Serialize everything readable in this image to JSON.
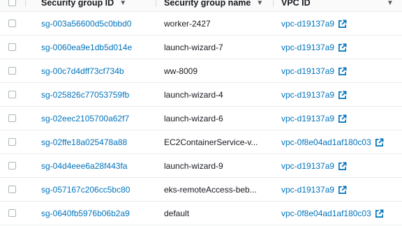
{
  "table": {
    "columns": [
      {
        "label": "Security group ID"
      },
      {
        "label": "Security group name"
      },
      {
        "label": "VPC ID"
      }
    ],
    "sort_icon": "caret-down-icon",
    "external_icon": "external-link-icon",
    "rows": [
      {
        "id": "sg-003a56600d5c0bbd0",
        "name": "worker-2427",
        "vpc": "vpc-d19137a9"
      },
      {
        "id": "sg-0060ea9e1db5d014e",
        "name": "launch-wizard-7",
        "vpc": "vpc-d19137a9"
      },
      {
        "id": "sg-00c7d4dff73cf734b",
        "name": "ww-8009",
        "vpc": "vpc-d19137a9"
      },
      {
        "id": "sg-025826c77053759fb",
        "name": "launch-wizard-4",
        "vpc": "vpc-d19137a9"
      },
      {
        "id": "sg-02eec2105700a62f7",
        "name": "launch-wizard-6",
        "vpc": "vpc-d19137a9"
      },
      {
        "id": "sg-02ffe18a025478a88",
        "name": "EC2ContainerService-v...",
        "vpc": "vpc-0f8e04ad1af180c03"
      },
      {
        "id": "sg-04d4eee6a28f443fa",
        "name": "launch-wizard-9",
        "vpc": "vpc-d19137a9"
      },
      {
        "id": "sg-057167c206cc5bc80",
        "name": "eks-remoteAccess-beb...",
        "vpc": "vpc-d19137a9"
      },
      {
        "id": "sg-0640fb5976b06b2a9",
        "name": "default",
        "vpc": "vpc-0f8e04ad1af180c03"
      }
    ]
  },
  "colors": {
    "link": "#0073bb",
    "text": "#16191f",
    "border": "#eaeded"
  }
}
